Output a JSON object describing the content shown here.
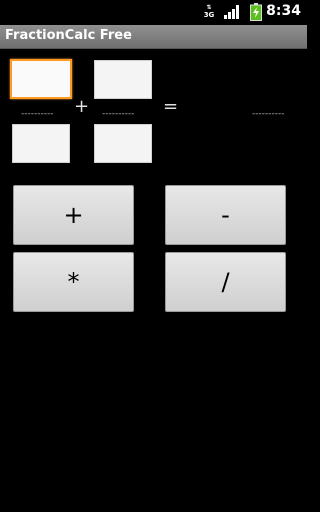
{
  "status_bar": {
    "time": "8:34",
    "network": "3G",
    "icons": [
      "network-3g-icon",
      "signal-icon",
      "battery-icon"
    ]
  },
  "app": {
    "title": "FractionCalc Free"
  },
  "fraction1": {
    "numerator": "",
    "denominator": "",
    "bar": "----------"
  },
  "fraction2": {
    "numerator": "",
    "denominator": "",
    "bar": "----------"
  },
  "operator_display": "+",
  "equals": "=",
  "result": {
    "bar": "----------"
  },
  "buttons": {
    "add": "+",
    "subtract": "-",
    "multiply": "*",
    "divide": "/"
  },
  "colors": {
    "focus_border": "#ff9a26",
    "title_bar": "#808080",
    "background": "#000000"
  }
}
